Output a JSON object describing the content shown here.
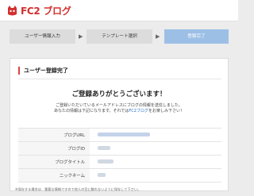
{
  "header": {
    "logo_text": "FC2 ブログ"
  },
  "steps": [
    {
      "label": "ユーザー情報入力",
      "active": false
    },
    {
      "label": "テンプレート選択",
      "active": false
    },
    {
      "label": "登録完了",
      "active": true
    }
  ],
  "step_arrow": "▶",
  "panel": {
    "section_title": "ユーザー登録完了",
    "thanks": "ご登録ありがとうございます！",
    "message_line1": "ご登録いただいているメールアドレスにブログの情報を送信しました。",
    "message_line2_before": "あなたの情報は下記になります。それでは",
    "message_line2_link": "FC2ブログ",
    "message_line2_after": "をお楽しみ下さい！"
  },
  "info_rows": [
    {
      "key": "ブログURL"
    },
    {
      "key": "ブログID"
    },
    {
      "key": "ブログタイトル"
    },
    {
      "key": "ニックネーム"
    }
  ],
  "note": "※保存する場合は、重要な情報ですので他人の目に触れないように保存して下さい。",
  "colors": {
    "brand": "#d32f2f",
    "active_step": "#9cbfe6",
    "link": "#2a6fc9"
  }
}
